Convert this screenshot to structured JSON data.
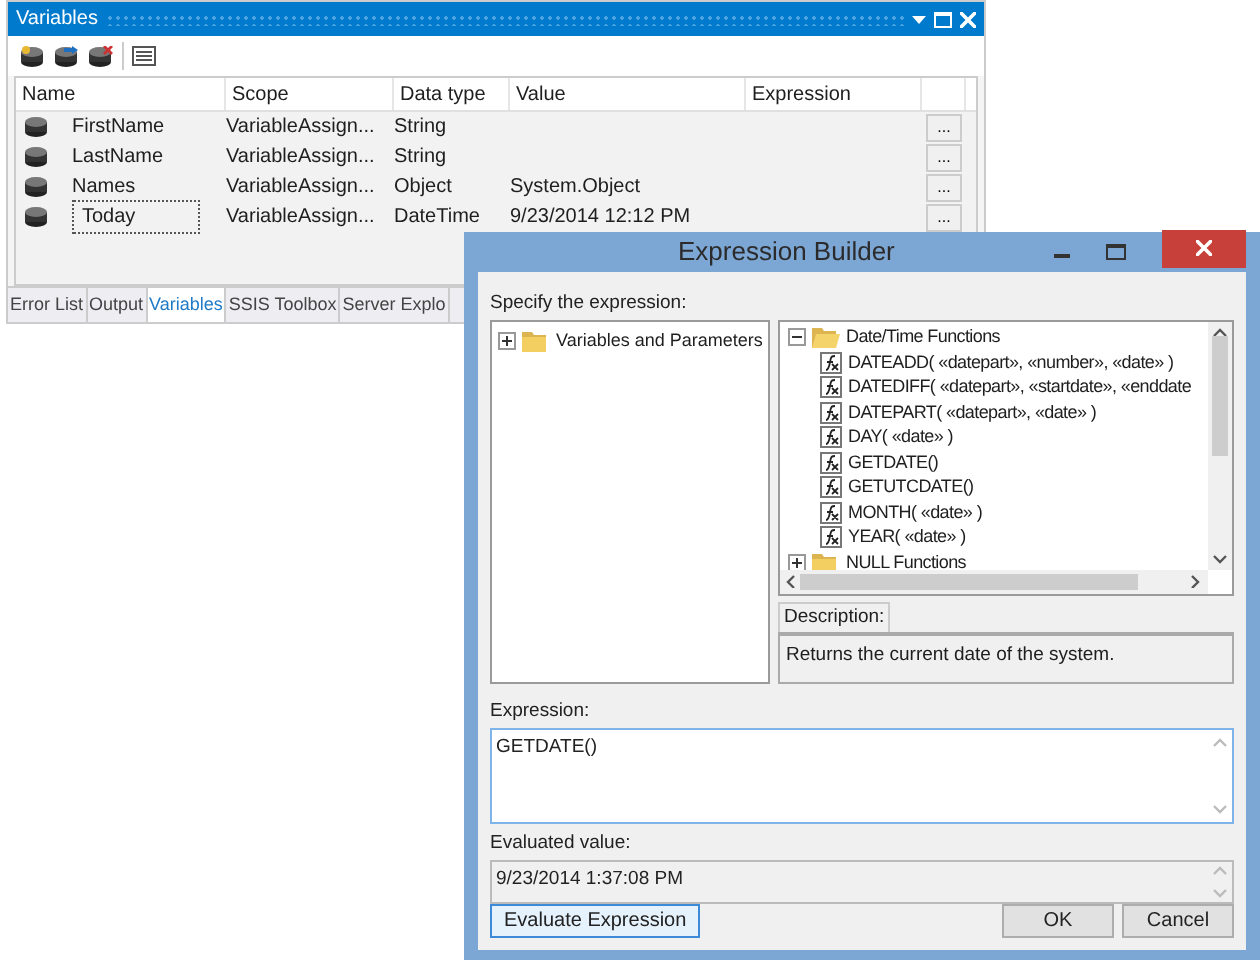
{
  "variables_panel": {
    "title": "Variables",
    "columns": [
      "Name",
      "Scope",
      "Data type",
      "Value",
      "Expression"
    ],
    "rows": [
      {
        "name": "FirstName",
        "scope": "VariableAssign...",
        "data_type": "String",
        "button": "...",
        "focused": false
      },
      {
        "name": "LastName",
        "scope": "VariableAssign...",
        "data_type": "String",
        "button": "...",
        "focused": false
      },
      {
        "name": "Names",
        "scope": "VariableAssign...",
        "data_type": "Object",
        "value": "System.Object",
        "button": "...",
        "focused": false
      },
      {
        "name": "Today",
        "scope": "VariableAssign...",
        "data_type": "DateTime",
        "value": "9/23/2014 12:12 PM",
        "button": "...",
        "focused": true
      }
    ],
    "tabs": [
      {
        "label": "Error List",
        "selected": false
      },
      {
        "label": "Output",
        "selected": false
      },
      {
        "label": "Variables",
        "selected": true
      },
      {
        "label": "SSIS Toolbox",
        "selected": false
      },
      {
        "label": "Server Explo",
        "selected": false
      }
    ]
  },
  "dialog": {
    "title": "Expression Builder",
    "specify_label": "Specify the expression:",
    "variables_tree": [
      {
        "label": "Variables and Parameters",
        "expanded": false
      }
    ],
    "functions_tree": [
      {
        "label": "Date/Time Functions",
        "expanded": true,
        "children": [
          {
            "label": "DATEADD( «datepart», «number», «date» )"
          },
          {
            "label": "DATEDIFF( «datepart», «startdate», «enddate"
          },
          {
            "label": "DATEPART( «datepart», «date» )"
          },
          {
            "label": "DAY( «date» )"
          },
          {
            "label": "GETDATE()"
          },
          {
            "label": "GETUTCDATE()"
          },
          {
            "label": "MONTH( «date» )"
          },
          {
            "label": "YEAR( «date» )"
          }
        ]
      },
      {
        "label": "NULL Functions",
        "expanded": false
      }
    ],
    "description_label": "Description:",
    "description": "Returns the current date of the system.",
    "expression_label": "Expression:",
    "expression": "GETDATE()",
    "evaluated_label": "Evaluated value:",
    "evaluated_value": "9/23/2014 1:37:08 PM",
    "buttons": [
      {
        "label": "Evaluate Expression",
        "kind": "left"
      },
      {
        "label": "OK",
        "kind": "right"
      },
      {
        "label": "Cancel",
        "kind": "right"
      }
    ]
  }
}
